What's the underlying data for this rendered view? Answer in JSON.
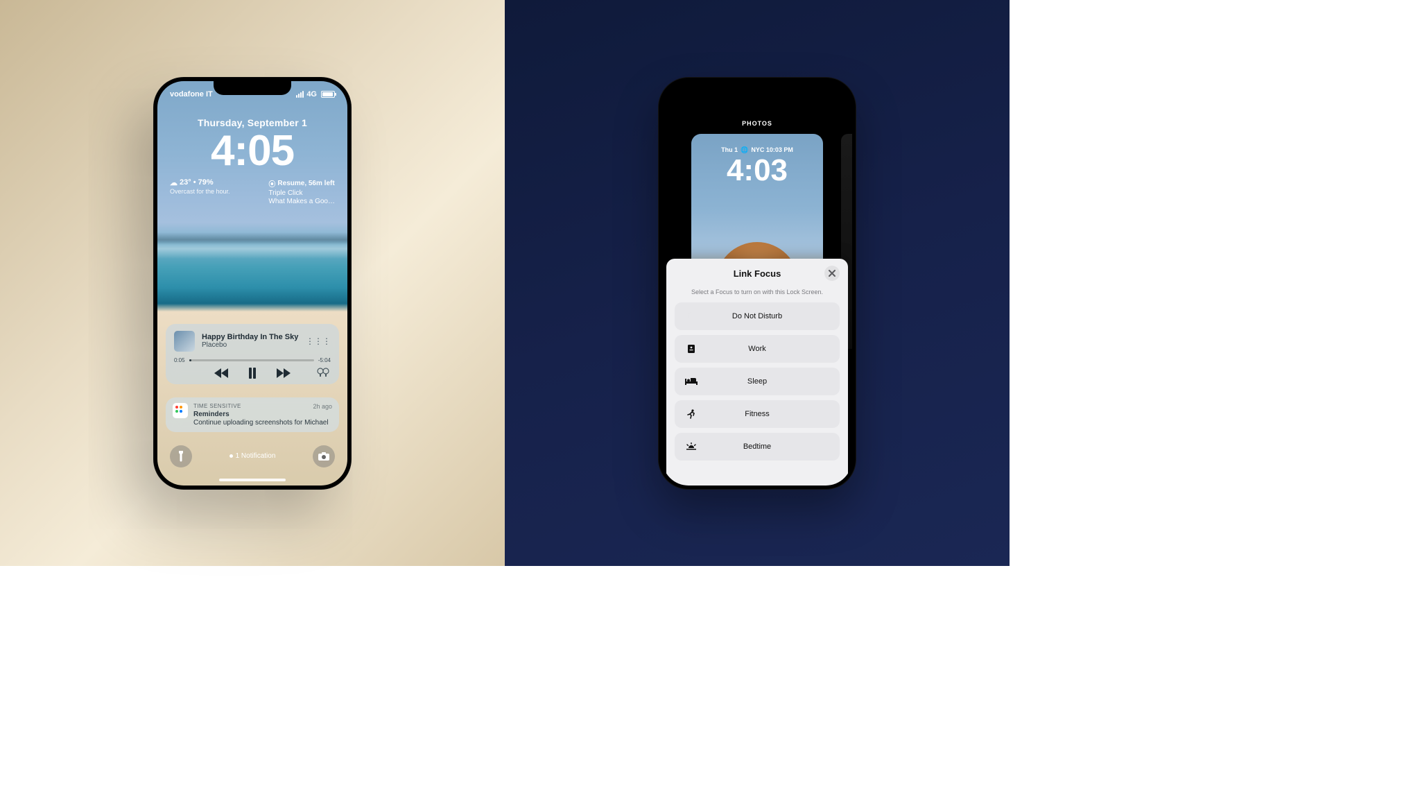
{
  "left": {
    "status": {
      "carrier": "vodafone IT",
      "network": "4G"
    },
    "date": "Thursday, September 1",
    "time": "4:05",
    "weather": {
      "temp_line": "23° • 79%",
      "desc": "Overcast for the hour."
    },
    "podcast": {
      "resume": "Resume, 56m left",
      "show": "Triple Click",
      "episode": "What Makes a Goo…"
    },
    "music": {
      "title": "Happy Birthday In The Sky",
      "artist": "Placebo",
      "elapsed": "0:05",
      "remaining": "-5:04"
    },
    "notification": {
      "tag": "TIME SENSITIVE",
      "app": "Reminders",
      "text": "Continue uploading screenshots for Michael",
      "time": "2h ago"
    },
    "bottom_text": "1 Notification"
  },
  "right": {
    "photos_label": "PHOTOS",
    "preview": {
      "date": "Thu 1",
      "city_time": "NYC 10:03 PM",
      "time": "4:03"
    },
    "sheet": {
      "title": "Link Focus",
      "subtitle": "Select a Focus to turn on with this Lock Screen.",
      "items": [
        {
          "label": "Do Not Disturb",
          "icon": "moon"
        },
        {
          "label": "Work",
          "icon": "badge"
        },
        {
          "label": "Sleep",
          "icon": "bed"
        },
        {
          "label": "Fitness",
          "icon": "runner"
        },
        {
          "label": "Bedtime",
          "icon": "sunset"
        }
      ]
    }
  }
}
